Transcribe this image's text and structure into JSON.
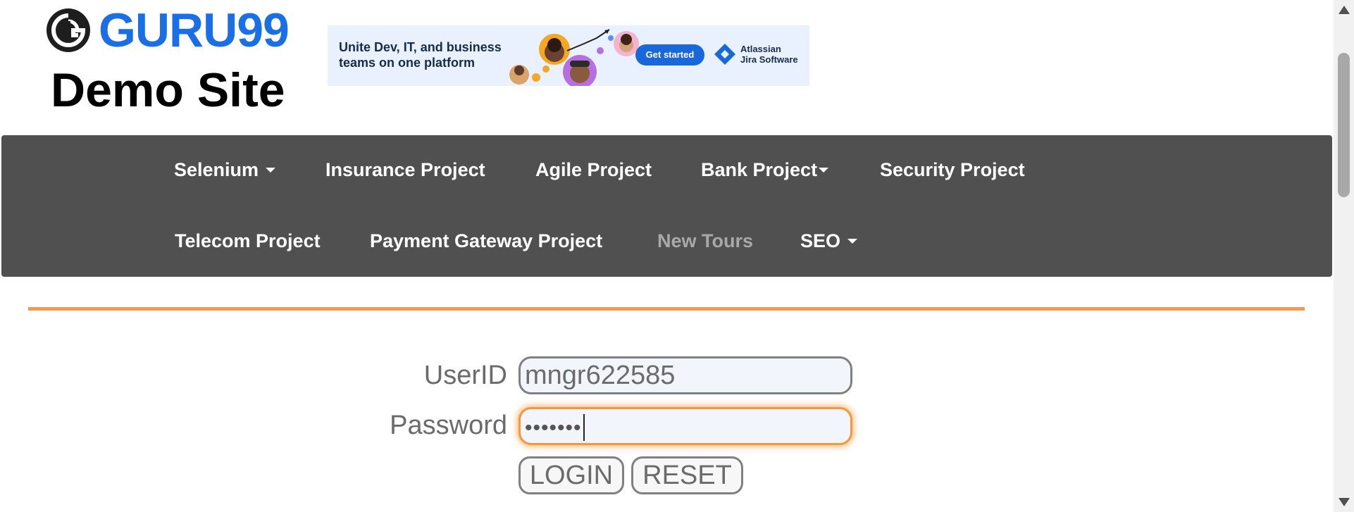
{
  "header": {
    "brand": "GURU99",
    "subtitle": "Demo Site"
  },
  "ad": {
    "headline": "Unite Dev, IT, and business teams on one platform",
    "cta": "Get started",
    "vendor_line1": "Atlassian",
    "vendor_line2": "Jira Software"
  },
  "nav": {
    "row1": [
      {
        "label": "Selenium",
        "dropdown": true
      },
      {
        "label": "Insurance Project",
        "dropdown": false
      },
      {
        "label": "Agile Project",
        "dropdown": false
      },
      {
        "label": "Bank Project",
        "dropdown": true
      },
      {
        "label": "Security Project",
        "dropdown": false
      }
    ],
    "row2": [
      {
        "label": "Telecom Project",
        "dropdown": false
      },
      {
        "label": "Payment Gateway Project",
        "dropdown": false
      },
      {
        "label": "New Tours",
        "dropdown": false,
        "state": "muted"
      },
      {
        "label": "SEO",
        "dropdown": true
      }
    ]
  },
  "login": {
    "userid_label": "UserID",
    "userid_value": "mngr622585",
    "password_label": "Password",
    "password_masked": "•••••••",
    "login_button": "LOGIN",
    "reset_button": "RESET"
  },
  "colors": {
    "brand_blue": "#1a6ee6",
    "navbar_bg": "#505050",
    "accent_orange": "#f09a54",
    "muted_nav": "#a8a8a8"
  }
}
